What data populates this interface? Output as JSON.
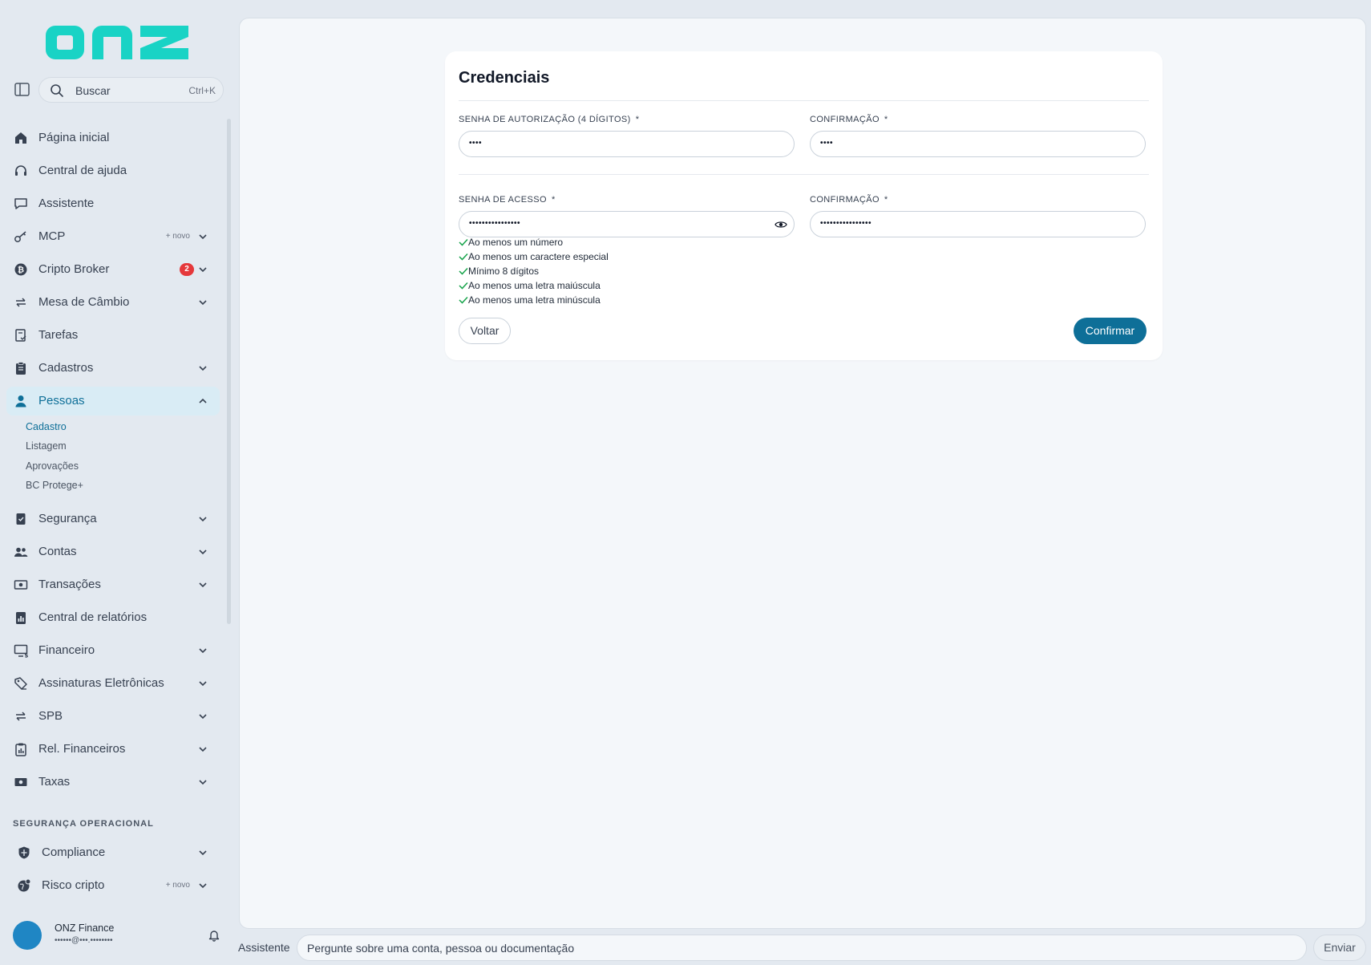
{
  "brand": {
    "logo_text": "onz",
    "accent": "#19d3c5",
    "primary": "#0e6f98"
  },
  "search": {
    "label": "Buscar",
    "shortcut": "Ctrl+K"
  },
  "sidebar": {
    "items": [
      {
        "label": "Página inicial",
        "icon": "home-icon"
      },
      {
        "label": "Central de ajuda",
        "icon": "headset-icon"
      },
      {
        "label": "Assistente",
        "icon": "chat-icon"
      },
      {
        "label": "MCP",
        "icon": "key-icon",
        "tag": "+ novo"
      },
      {
        "label": "Cripto Broker",
        "icon": "bitcoin-icon",
        "badge": "2"
      },
      {
        "label": "Mesa de Câmbio",
        "icon": "exchange-icon"
      },
      {
        "label": "Tarefas",
        "icon": "task-icon"
      },
      {
        "label": "Cadastros",
        "icon": "clipboard-icon"
      },
      {
        "label": "Pessoas",
        "icon": "person-icon"
      },
      {
        "label": "Segurança",
        "icon": "shield-check-icon"
      },
      {
        "label": "Contas",
        "icon": "people-icon"
      },
      {
        "label": "Transações",
        "icon": "money-icon"
      },
      {
        "label": "Central de relatórios",
        "icon": "report-icon"
      },
      {
        "label": "Financeiro",
        "icon": "monitor-money-icon"
      },
      {
        "label": "Assinaturas Eletrônicas",
        "icon": "signature-icon"
      },
      {
        "label": "SPB",
        "icon": "exchange-icon"
      },
      {
        "label": "Rel. Financeiros",
        "icon": "clipboard-chart-icon"
      },
      {
        "label": "Taxas",
        "icon": "money-icon"
      }
    ],
    "sub_items": [
      "Cadastro",
      "Listagem",
      "Aprovações",
      "BC Protege+"
    ],
    "section_title": "SEGURANÇA OPERACIONAL",
    "section_items": [
      {
        "label": "Compliance",
        "icon": "shield-icon"
      },
      {
        "label": "Risco cripto",
        "icon": "globe-icon",
        "tag": "+ novo"
      }
    ],
    "user": {
      "name": "ONZ Finance",
      "email": "••••••@•••.••••••••"
    }
  },
  "form": {
    "title": "Credenciais",
    "auth_password": {
      "label": "SENHA DE AUTORIZAÇÃO (4 DÍGITOS)",
      "value": "••••"
    },
    "auth_confirm": {
      "label": "CONFIRMAÇÃO",
      "value": "••••"
    },
    "access_password": {
      "label": "SENHA DE ACESSO",
      "value": "••••••••••••••••"
    },
    "access_confirm": {
      "label": "CONFIRMAÇÃO",
      "value": "••••••••••••••••"
    },
    "required_mark": "*",
    "requirements": [
      "Ao menos um número",
      "Ao menos um caractere especial",
      "Mínimo 8 dígitos",
      "Ao menos uma letra maiúscula",
      "Ao menos uma letra minúscula"
    ],
    "back_label": "Voltar",
    "confirm_label": "Confirmar"
  },
  "assistant": {
    "label": "Assistente",
    "placeholder": "Pergunte sobre uma conta, pessoa ou documentação",
    "send_label": "Enviar"
  }
}
